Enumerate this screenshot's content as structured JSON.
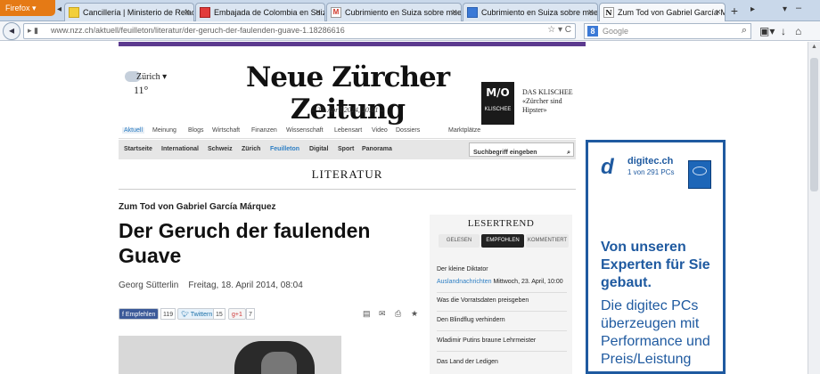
{
  "browser": {
    "firefox_button": "Firefox",
    "tabs": [
      {
        "label": "Cancillería | Ministerio de Relacio...",
        "icon": "flag-icon"
      },
      {
        "label": "Embajada de Colombia en Suiza",
        "icon": "flag-icon"
      },
      {
        "label": "Cubrimiento en Suiza sobre muert...",
        "icon": "gmail-icon"
      },
      {
        "label": "Cubrimiento en Suiza sobre muert...",
        "icon": "docs-icon"
      },
      {
        "label": "Zum Tod von Gabriel García Márqu...",
        "icon": "nzz-icon",
        "active": true
      }
    ],
    "new_tab": "+",
    "url": "www.nzz.ch/aktuell/feuilleton/literatur/der-geruch-der-faulenden-guave-1.18286616",
    "search_placeholder": "Google",
    "search_engine_letter": "8"
  },
  "site": {
    "weather": {
      "city": "Zürich ▾",
      "temp": "11°"
    },
    "logo": "Neue Zürcher Zeitung",
    "dateline": "– 28. April 2014, 10:01 –",
    "mo_logo": "M/O",
    "mo_sub": "KLISCHEE",
    "klischee_title": "DAS KLISCHEE",
    "klischee_text": "«Zürcher sind Hipster»",
    "nav_main": [
      "Aktuell",
      "Meinung",
      "Blogs",
      "Wirtschaft",
      "Finanzen",
      "Wissenschaft",
      "Lebensart",
      "Video",
      "Dossiers",
      "Marktplätze"
    ],
    "nav_sub": [
      "Startseite",
      "International",
      "Schweiz",
      "Zürich",
      "Feuilleton",
      "Digital",
      "Sport",
      "Panorama"
    ],
    "search_placeholder": "Suchbegriff eingeben",
    "rubric": "LITERATUR"
  },
  "article": {
    "kicker": "Zum Tod von Gabriel García Márquez",
    "headline": "Der Geruch der faulenden Guave",
    "author": "Georg Sütterlin",
    "date": "Freitag, 18. April 2014, 08:04",
    "share": {
      "facebook": "Empfehlen",
      "facebook_count": "119",
      "twitter": "Twittern",
      "twitter_count": "15",
      "gplus": "+1",
      "gplus_count": "7"
    }
  },
  "lesertrend": {
    "title": "LESERTREND",
    "tabs": [
      "GELESEN",
      "EMPFOHLEN",
      "KOMMENTIERT"
    ],
    "items": [
      "Der kleine Diktator",
      "Was die Vorratsdaten preisgeben",
      "Den Blindflug verhindern",
      "Wladimir Putins braune Lehrmeister",
      "Das Land der Ledigen"
    ],
    "first_section": "Auslandnachrichten",
    "first_date": "Mittwoch, 23. April, 10:00"
  },
  "ad": {
    "brand": "digitec.ch",
    "sub": "1 von 291 PCs",
    "line1": "Von unseren Experten für Sie gebaut.",
    "line2": "Die digitec PCs überzeugen mit Performance und Preis/Leistung"
  },
  "colors": {
    "accent": "#2e7fc4",
    "brand_bar": "#5c3a8f",
    "ad_blue": "#1f5aa0",
    "firefox": "#e57a15"
  }
}
